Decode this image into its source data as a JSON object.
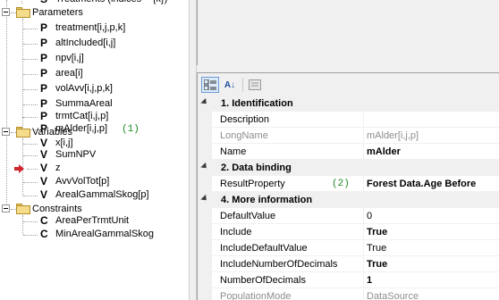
{
  "tree": {
    "partial_top": {
      "glyph": "S",
      "label": "Treatments (indices = {k})"
    },
    "groups": [
      {
        "label": "Parameters",
        "items": [
          {
            "glyph": "P",
            "label": "treatment[i,j,p,k]"
          },
          {
            "glyph": "P",
            "label": "altIncluded[i,j]"
          },
          {
            "glyph": "P",
            "label": "npv[i,j]"
          },
          {
            "glyph": "P",
            "label": "area[i]"
          },
          {
            "glyph": "P",
            "label": "volAvv[i,j,p,k]"
          },
          {
            "glyph": "P",
            "label": "SummaAreal"
          },
          {
            "glyph": "P",
            "label": "trmtCat[i,j,p]"
          },
          {
            "glyph": "P",
            "label": "mAlder[i,j,p]",
            "annotation": "(1)"
          }
        ]
      },
      {
        "label": "Variables",
        "items": [
          {
            "glyph": "V",
            "label": "x[i,j]"
          },
          {
            "glyph": "V",
            "label": "SumNPV"
          },
          {
            "glyph": "V",
            "label": "z",
            "marked": true
          },
          {
            "glyph": "V",
            "label": "AvvVolTot[p]"
          },
          {
            "glyph": "V",
            "label": "ArealGammalSkog[p]"
          }
        ]
      },
      {
        "label": "Constraints",
        "items": [
          {
            "glyph": "C",
            "label": "AreaPerTrmtUnit"
          },
          {
            "glyph": "C",
            "label": "MinArealGammalSkog"
          }
        ]
      }
    ]
  },
  "toolbar": {
    "categorized_icon": "categorized-icon",
    "alphabetical_icon": "alphabetical-sort-icon",
    "alphabetical_text": "A↓",
    "property_pages_icon": "property-pages-icon"
  },
  "grid": {
    "categories": [
      {
        "label": "1. Identification",
        "rows": [
          {
            "name": "Description",
            "value": "",
            "readonly": false,
            "bold": false
          },
          {
            "name": "LongName",
            "value": "mAlder[i,j,p]",
            "readonly": true,
            "bold": false
          },
          {
            "name": "Name",
            "value": "mAlder",
            "readonly": false,
            "bold": true
          }
        ]
      },
      {
        "label": "2. Data binding",
        "rows": [
          {
            "name": "ResultProperty",
            "value": "Forest Data.Age Before",
            "readonly": false,
            "bold": true,
            "annotation": "(2)"
          }
        ]
      },
      {
        "label": "4. More information",
        "rows": [
          {
            "name": "DefaultValue",
            "value": "0",
            "readonly": false,
            "bold": false
          },
          {
            "name": "Include",
            "value": "True",
            "readonly": false,
            "bold": true
          },
          {
            "name": "IncludeDefaultValue",
            "value": "True",
            "readonly": false,
            "bold": false
          },
          {
            "name": "IncludeNumberOfDecimals",
            "value": "True",
            "readonly": false,
            "bold": true
          },
          {
            "name": "NumberOfDecimals",
            "value": "1",
            "readonly": false,
            "bold": true
          },
          {
            "name": "PopulationMode",
            "value": "DataSource",
            "readonly": true,
            "bold": false
          }
        ]
      }
    ]
  },
  "colors": {
    "annotation": "#1c8a1c",
    "marker": "#d0262e",
    "readonly_text": "#8d8d8d",
    "panel": "#f0f0f0"
  }
}
